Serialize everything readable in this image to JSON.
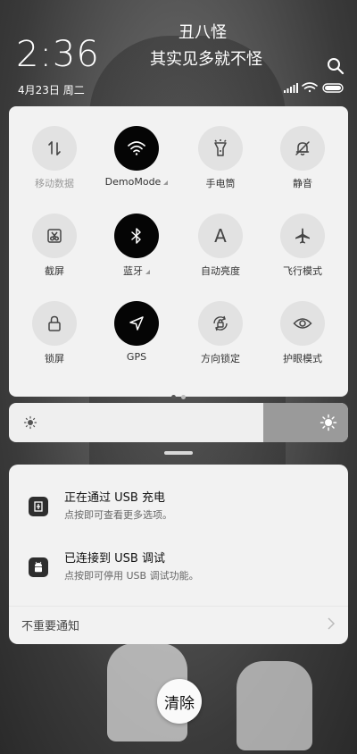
{
  "lockscreen": {
    "time": "2:36",
    "date": "4月23日 周二",
    "banner_line1": "丑八怪",
    "banner_line2": "其实见多就不怪"
  },
  "quick_settings": {
    "tiles": [
      {
        "label": "移动数据",
        "icon": "mobile-data-icon",
        "active": false,
        "dimmed": true
      },
      {
        "label": "DemoMode",
        "icon": "wifi-icon",
        "active": true,
        "has_expand": true
      },
      {
        "label": "手电筒",
        "icon": "flashlight-icon",
        "active": false
      },
      {
        "label": "静音",
        "icon": "bell-mute-icon",
        "active": false
      },
      {
        "label": "截屏",
        "icon": "screenshot-icon",
        "active": false
      },
      {
        "label": "蓝牙",
        "icon": "bluetooth-icon",
        "active": true,
        "has_expand": true
      },
      {
        "label": "自动亮度",
        "icon": "auto-brightness-icon",
        "active": false
      },
      {
        "label": "飞行模式",
        "icon": "airplane-icon",
        "active": false
      },
      {
        "label": "锁屏",
        "icon": "lock-icon",
        "active": false
      },
      {
        "label": "GPS",
        "icon": "gps-icon",
        "active": true
      },
      {
        "label": "方向锁定",
        "icon": "rotation-lock-icon",
        "active": false
      },
      {
        "label": "护眼模式",
        "icon": "eye-icon",
        "active": false
      }
    ],
    "page_count": 2,
    "current_page": 1
  },
  "brightness": {
    "level": 0.25
  },
  "notifications": [
    {
      "title": "正在通过 USB 充电",
      "subtitle": "点按即可查看更多选项。",
      "icon": "usb-charging-icon"
    },
    {
      "title": "已连接到 USB 调试",
      "subtitle": "点按即可停用 USB 调试功能。",
      "icon": "android-icon"
    }
  ],
  "notification_footer": "不重要通知",
  "clear_label": "清除",
  "colors": {
    "active_tile": "#050505",
    "inactive_tile": "#e2e2e2",
    "panel": "#f2f2f2"
  }
}
